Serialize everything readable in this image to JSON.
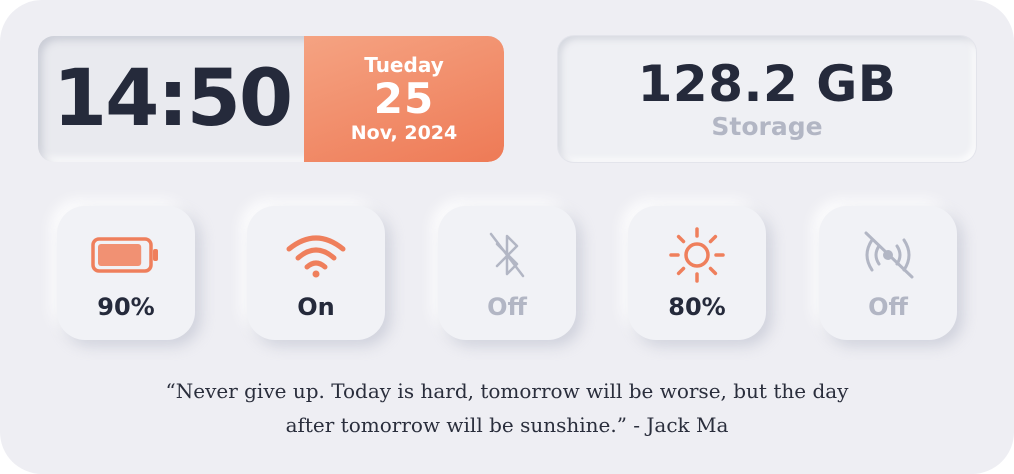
{
  "clock": {
    "time": "14:50",
    "weekday": "Tueday",
    "day": "25",
    "month_year": "Nov, 2024"
  },
  "storage": {
    "value": "128.2 GB",
    "label": "Storage"
  },
  "tiles": [
    {
      "icon": "battery-icon",
      "label": "90%",
      "active": true,
      "level": 0.9
    },
    {
      "icon": "wifi-icon",
      "label": "On",
      "active": true
    },
    {
      "icon": "bluetooth-icon",
      "label": "Off",
      "active": false
    },
    {
      "icon": "brightness-icon",
      "label": "80%",
      "active": true,
      "level": 0.8
    },
    {
      "icon": "hotspot-off-icon",
      "label": "Off",
      "active": false
    }
  ],
  "quote": {
    "line1": "“Never give up. Today is hard, tomorrow will be worse, but the day",
    "line2": "after tomorrow will be sunshine.” - Jack Ma"
  },
  "colors": {
    "accent": "#ef7f5c",
    "text_dark": "#252a3b",
    "text_muted": "#b2b6c4",
    "background": "#eeeef3"
  }
}
